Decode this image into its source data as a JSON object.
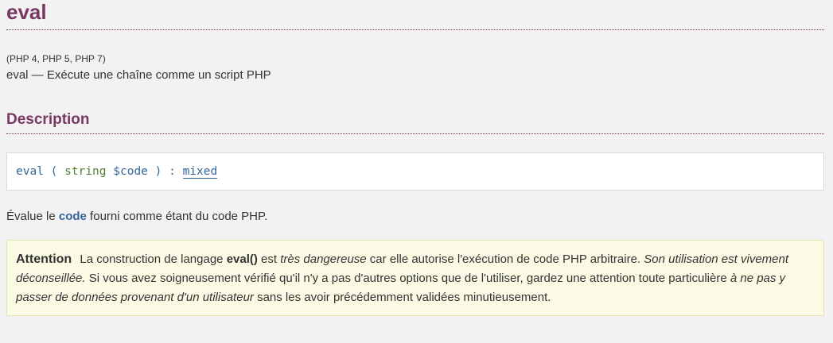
{
  "refentry": {
    "title": "eval",
    "versions": "(PHP 4, PHP 5, PHP 7)",
    "purpose": "eval — Exécute une chaîne comme un script PHP"
  },
  "description": {
    "heading": "Description",
    "synopsis": {
      "function_name": "eval",
      "open_paren": "(",
      "param_type": "string",
      "param_name": "$code",
      "close_paren": ")",
      "colon": ":",
      "return_type": "mixed"
    },
    "text_before": "Évalue le ",
    "text_code": "code",
    "text_after": " fourni comme étant du code PHP."
  },
  "warning": {
    "title": "Attention",
    "part1": "La construction de langage ",
    "bold1": "eval()",
    "part2": " est ",
    "italic1": "très dangereuse",
    "part3": " car elle autorise l'exécution de code PHP arbitraire. ",
    "italic2": "Son utilisation est vivement déconseillée.",
    "part4": " Si vous avez soigneusement vérifié qu'il n'y a pas d'autres options que de l'utiliser, gardez une attention toute particulière ",
    "italic3": "à ne pas y passer de données provenant d'un utilisateur",
    "part5": " sans les avoir précédemment validées minutieusement."
  },
  "colors": {
    "heading": "#793862",
    "link": "#336699",
    "type": "#4f7f2f",
    "background": "#f2f2f2",
    "warning_bg": "#fbfbe5"
  }
}
